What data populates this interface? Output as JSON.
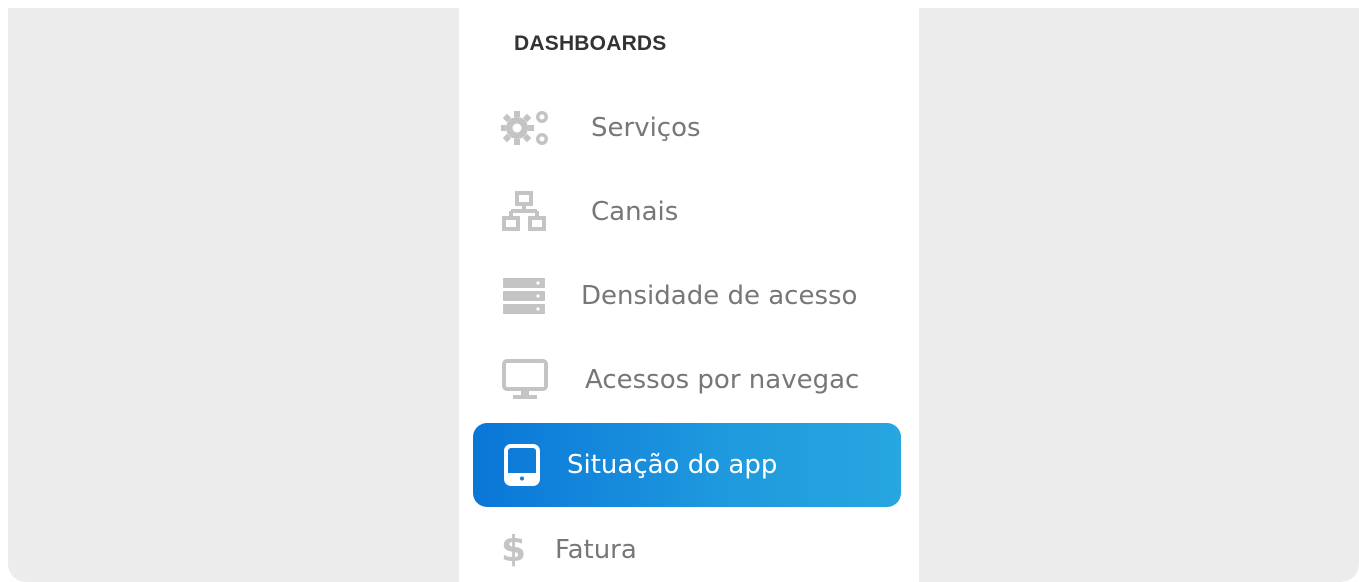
{
  "sidebar": {
    "section_title": "DASHBOARDS",
    "items": [
      {
        "label": "Serviços",
        "icon": "gears-icon",
        "active": false
      },
      {
        "label": "Canais",
        "icon": "network-icon",
        "active": false
      },
      {
        "label": "Densidade de acesso",
        "icon": "server-icon",
        "active": false
      },
      {
        "label": "Acessos por navegac",
        "icon": "monitor-icon",
        "active": false
      },
      {
        "label": "Situação do app",
        "icon": "tablet-icon",
        "active": true
      },
      {
        "label": "Fatura",
        "icon": "dollar-icon",
        "active": false
      }
    ]
  },
  "colors": {
    "background": "#ececec",
    "panel": "#ffffff",
    "icon": "#c4c4c4",
    "label": "#777777",
    "active_start": "#0a76d8",
    "active_end": "#27a6e0"
  }
}
